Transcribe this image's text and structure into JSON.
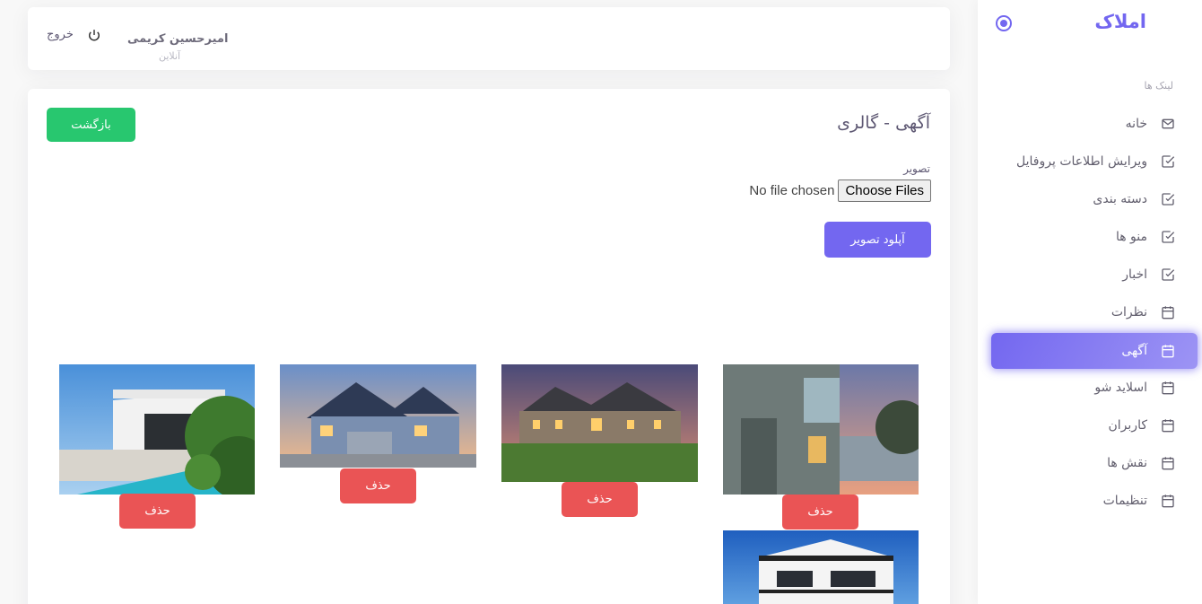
{
  "sidebar": {
    "brand": "املاک",
    "section_title": "لینک ها",
    "items": [
      {
        "label": "خانه",
        "icon": "mail-icon"
      },
      {
        "label": "ویرایش اطلاعات پروفایل",
        "icon": "check-square-icon"
      },
      {
        "label": "دسته بندی",
        "icon": "check-square-icon"
      },
      {
        "label": "منو ها",
        "icon": "check-square-icon"
      },
      {
        "label": "اخبار",
        "icon": "check-square-icon"
      },
      {
        "label": "نظرات",
        "icon": "calendar-icon"
      },
      {
        "label": "آگهی",
        "icon": "calendar-icon",
        "active": true
      },
      {
        "label": "اسلاید شو",
        "icon": "calendar-icon"
      },
      {
        "label": "کاربران",
        "icon": "calendar-icon"
      },
      {
        "label": "نقش ها",
        "icon": "calendar-icon"
      },
      {
        "label": "تنظیمات",
        "icon": "calendar-icon"
      }
    ]
  },
  "navbar": {
    "user_name": "امیرحسین کریمی",
    "user_status": "آنلاین",
    "logout_label": "خروج"
  },
  "main": {
    "title": "آگهی - گالری",
    "back_label": "بازگشت",
    "image_label": "تصویر",
    "file_button": "Choose Files",
    "file_status": "No file chosen",
    "upload_label": "آپلود تصویر",
    "delete_label": "حذف"
  },
  "colors": {
    "primary": "#7367f0",
    "success": "#28c76f",
    "danger": "#ea5455"
  }
}
